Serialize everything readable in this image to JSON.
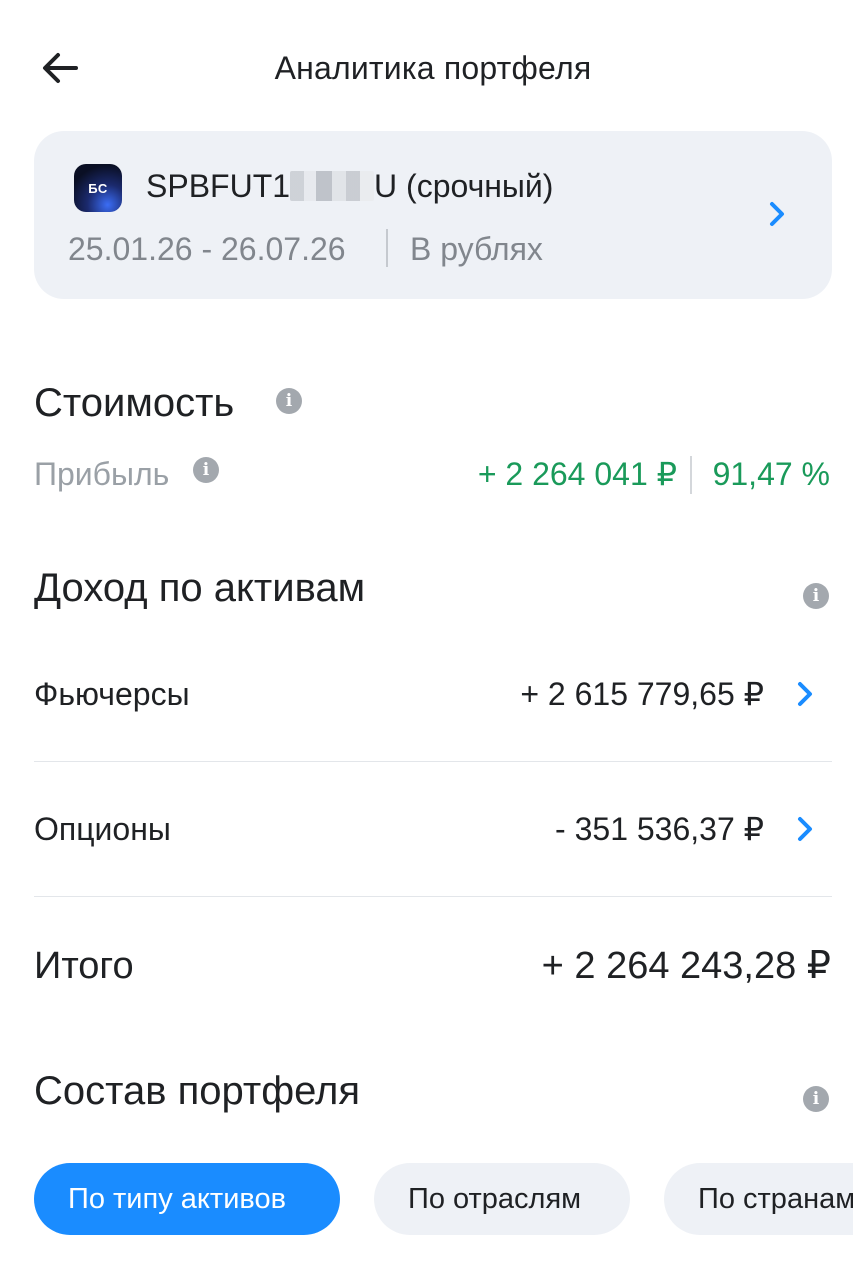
{
  "header": {
    "title": "Аналитика портфеля",
    "back_icon": "arrow-left-icon"
  },
  "account": {
    "logo_text": "БС",
    "name_prefix": "SPBFUT1",
    "name_suffix": "U (срочный)",
    "period": "25.01.26 - 26.07.26",
    "currency": "В рублях",
    "chevron_icon": "chevron-right-icon"
  },
  "value_section": {
    "title": "Стоимость",
    "profit_label": "Прибыль",
    "profit_amount": "+ 2 264 041 ₽",
    "profit_percent": "91,47 %"
  },
  "income_section": {
    "title": "Доход по активам",
    "rows": [
      {
        "label": "Фьючерсы",
        "value": "+ 2 615 779,65 ₽"
      },
      {
        "label": "Опционы",
        "value": "- 351 536,37 ₽"
      }
    ],
    "total_label": "Итого",
    "total_value": "+ 2 264 243,28 ₽"
  },
  "composition_section": {
    "title": "Состав портфеля",
    "chips": [
      {
        "label": "По типу активов",
        "active": true
      },
      {
        "label": "По отраслям",
        "active": false
      },
      {
        "label": "По странам",
        "active": false
      }
    ]
  },
  "colors": {
    "accent": "#1a8cff",
    "positive": "#1a9a5a",
    "card_bg": "#eef1f6",
    "muted_text": "#81868d"
  }
}
